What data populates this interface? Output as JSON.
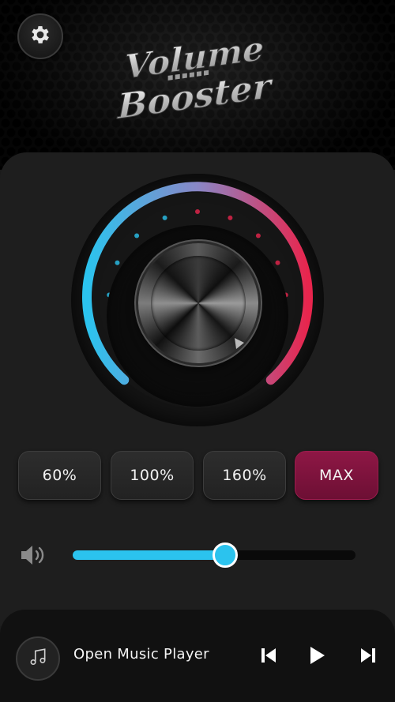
{
  "app": {
    "logo_line1": "Volume",
    "logo_line2": "Booster"
  },
  "colors": {
    "accent_blue": "#2bc3ee",
    "accent_red": "#e8254d",
    "active_preset": "#8e1745"
  },
  "icons": {
    "settings": "gear-icon",
    "volume": "speaker-icon",
    "music": "music-note-icon",
    "previous": "skip-previous-icon",
    "play": "play-icon",
    "next": "skip-next-icon"
  },
  "presets": [
    {
      "label": "60%"
    },
    {
      "label": "100%"
    },
    {
      "label": "160%"
    },
    {
      "label": "MAX",
      "active": true
    }
  ],
  "volume": {
    "level_fraction": 0.54
  },
  "player": {
    "label": "Open Music Player"
  }
}
